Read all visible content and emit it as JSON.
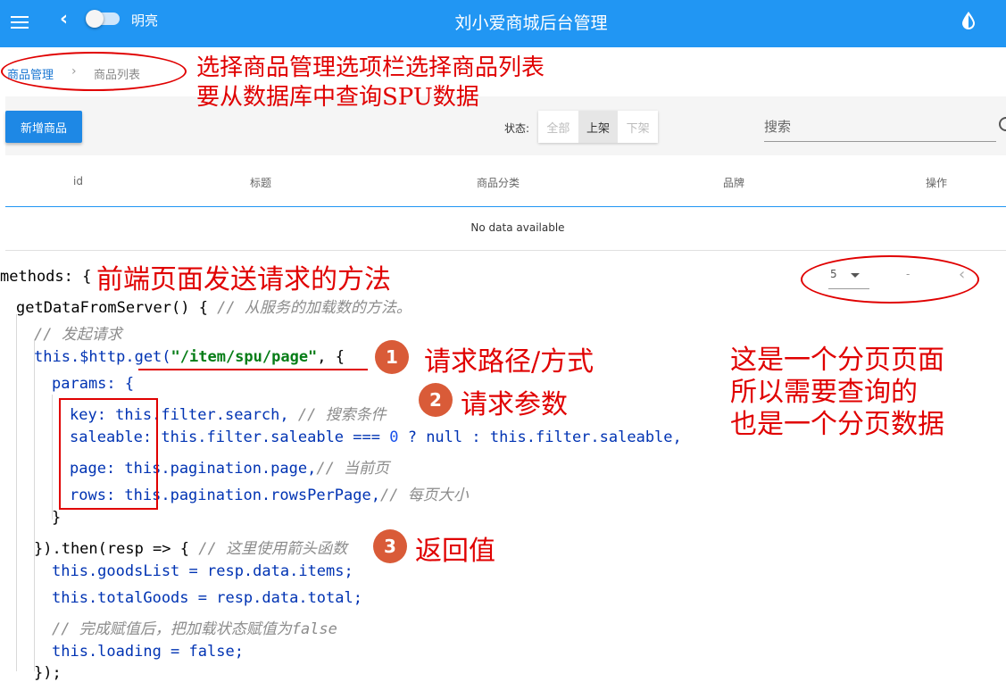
{
  "header": {
    "theme_label": "明亮",
    "title": "刘小爱商城后台管理",
    "icons": [
      "menu-icon",
      "back-icon",
      "drop-icon"
    ]
  },
  "breadcrumb": {
    "home": "商品管理",
    "separator": "›",
    "current": "商品列表"
  },
  "toolbar": {
    "add_label": "新增商品",
    "status_label": "状态:",
    "status_options": [
      "全部",
      "上架",
      "下架"
    ],
    "status_selected": "上架",
    "search_placeholder": "搜索"
  },
  "table": {
    "headers": [
      "id",
      "标题",
      "商品分类",
      "品牌",
      "操作"
    ],
    "empty_text": "No data available"
  },
  "pagination": {
    "rows_per_page": "5",
    "range": "-",
    "prev": "‹"
  },
  "code": {
    "line1": "methods: {",
    "line2": "getDataFromServer() { ",
    "line2_comment": "// 从服务的加载数的方法。",
    "line3_comment": "// 发起请求",
    "line4_a": "this.$http.get(",
    "line4_str": "\"/item/spu/page\"",
    "line4_b": ", {",
    "line5": "params: {",
    "line6": "key: this.filter.search, ",
    "line6_comment": "// 搜索条件",
    "line7_a": "saleable: this.filter.saleable === ",
    "line7_num": "0",
    "line7_b": " ? null : this.filter.saleable,",
    "line8": "page: this.pagination.page,",
    "line8_comment": "// 当前页",
    "line9": "rows: this.pagination.rowsPerPage,",
    "line9_comment": "// 每页大小",
    "line10": "}",
    "line11": "}).then(resp => { ",
    "line11_comment": "// 这里使用箭头函数",
    "line12": "this.goodsList = resp.data.items;",
    "line13": "this.totalGoods = resp.data.total;",
    "line14_comment": "// 完成赋值后，把加载状态赋值为false",
    "line15": "this.loading = false;",
    "line16": "});"
  },
  "annotations": {
    "top_note_line1": "选择商品管理选项栏选择商品列表",
    "top_note_line2": "要从数据库中查询SPU数据",
    "methods_note": "前端页面发送请求的方法",
    "badge1": "1",
    "badge1_text": "请求路径/方式",
    "badge2": "2",
    "badge2_text": "请求参数",
    "badge3": "3",
    "badge3_text": "返回值",
    "right_line1": "这是一个分页页面",
    "right_line2": "所以需要查询的",
    "right_line3": "也是一个分页数据"
  },
  "colors": {
    "primary": "#2196f3",
    "annotation": "#e00000",
    "badge": "#d95b38"
  }
}
